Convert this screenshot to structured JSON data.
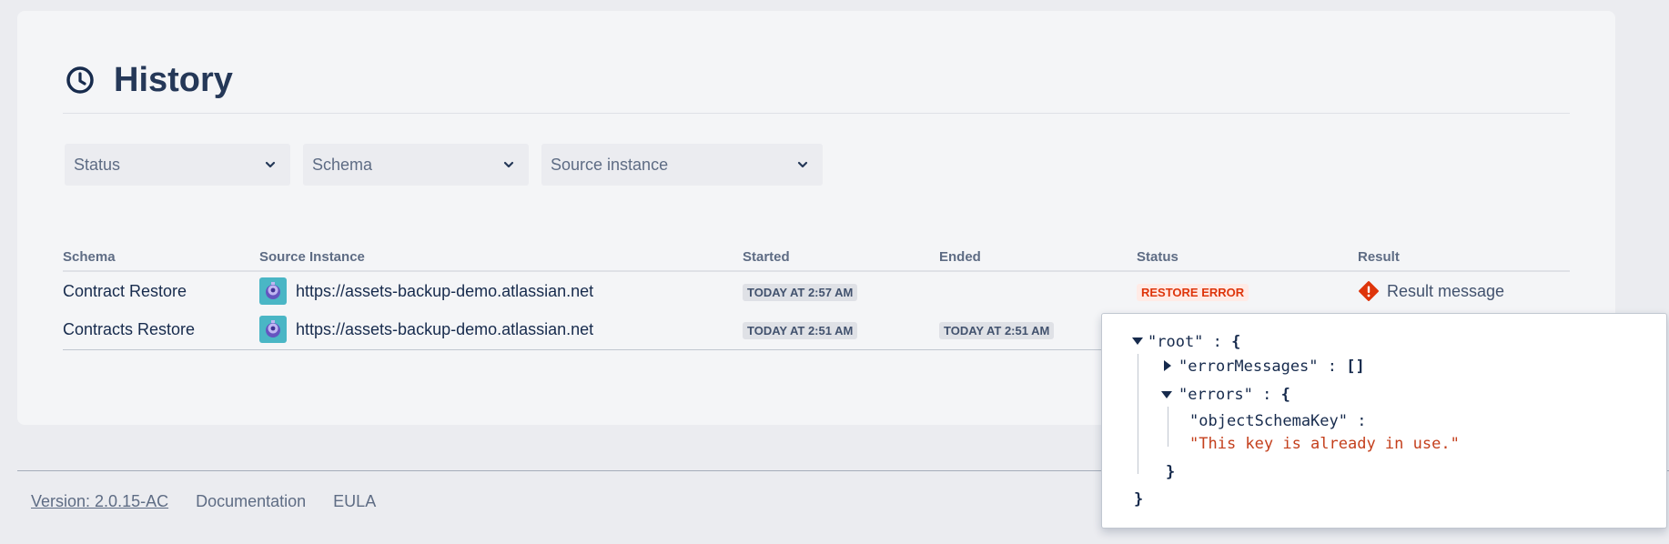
{
  "page": {
    "title": "History"
  },
  "filters": {
    "status": "Status",
    "schema": "Schema",
    "source_instance": "Source instance"
  },
  "table": {
    "headers": [
      "Schema",
      "Source Instance",
      "Started",
      "Ended",
      "Status",
      "Result"
    ],
    "rows": [
      {
        "schema": "Contract Restore",
        "instance": "https://assets-backup-demo.atlassian.net",
        "started": "TODAY AT 2:57 AM",
        "ended": "",
        "status": "RESTORE ERROR",
        "result": "Result message"
      },
      {
        "schema": "Contracts Restore",
        "instance": "https://assets-backup-demo.atlassian.net",
        "started": "TODAY AT 2:51 AM",
        "ended": "TODAY AT 2:51 AM",
        "status": "",
        "result": ""
      }
    ]
  },
  "footer": {
    "version": "Version: 2.0.15-AC",
    "documentation": "Documentation",
    "eula": "EULA"
  },
  "json_viewer": {
    "root_key": "\"root\"",
    "root_sep": ":",
    "open_brace": "{",
    "close_brace": "}",
    "error_messages_key": "\"errorMessages\"",
    "error_messages_value": "[]",
    "errors_key": "\"errors\"",
    "object_schema_key": "\"objectSchemaKey\"",
    "object_schema_value": "\"This key is already in use.\""
  },
  "colors": {
    "accent_error": "#de350b",
    "background": "#ebecf0",
    "card": "#f4f5f7",
    "avatar": "#4ab6c5"
  },
  "icons": {
    "history": "clock-icon",
    "dropdown": "chevron-down-icon",
    "error": "error-icon",
    "instance": "robot-avatar-icon"
  }
}
